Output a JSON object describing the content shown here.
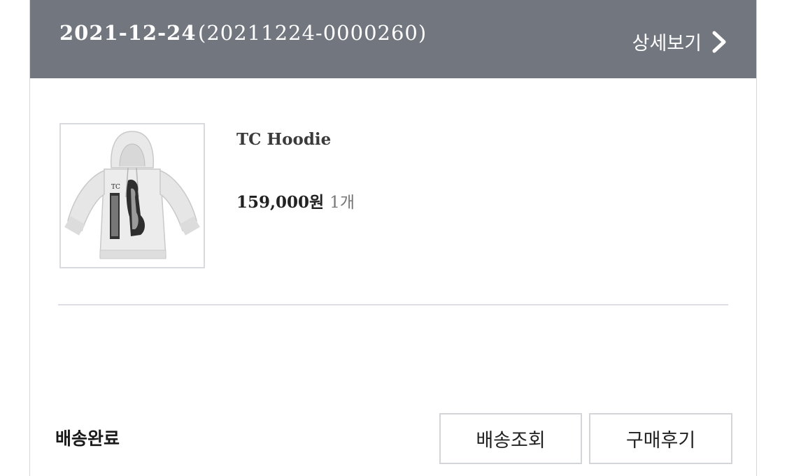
{
  "order": {
    "date": "2021-12-24",
    "number": "(20211224-0000260)",
    "detail_label": "상세보기"
  },
  "product": {
    "name": "TC Hoodie",
    "price": "159,000원",
    "quantity": "1개",
    "image_icon": "hoodie-product-icon"
  },
  "status": {
    "label": "배송완료"
  },
  "actions": {
    "track_label": "배송조회",
    "review_label": "구매후기"
  },
  "colors": {
    "header_bg": "#72767f",
    "header_text": "#ffffff",
    "border": "#d4d5d8"
  }
}
